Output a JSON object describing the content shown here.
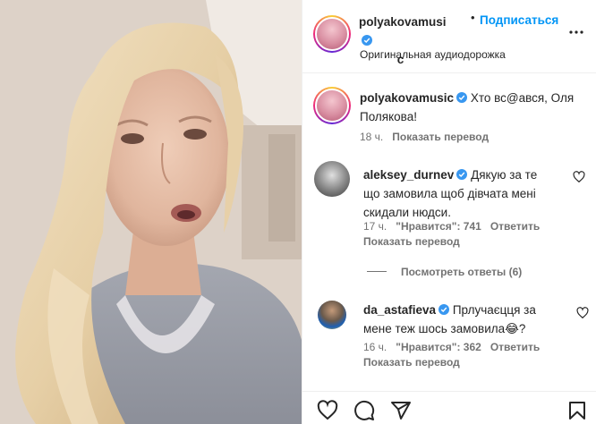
{
  "post": {
    "author": "polyakovamusic",
    "author_line1": "polyakovamusi",
    "author_line2": "c",
    "dot": "•",
    "follow_label": "Подписаться",
    "audio_label": "Оригинальная аудиодорожка"
  },
  "caption": {
    "username": "polyakovamusic",
    "text": "Хто вс@ався, Оля Полякова!",
    "time": "18 ч.",
    "translate": "Показать перевод"
  },
  "comments": [
    {
      "username": "aleksey_durnev",
      "text": "Дякую за те що замовила щоб дівчата мені скидали нюдси.",
      "time": "17 ч.",
      "likes": "\"Нравится\": 741",
      "reply": "Ответить",
      "translate": "Показать перевод"
    },
    {
      "username": "da_astafieva",
      "text": "Прлучаєцця за мене теж шось замовила😂?",
      "time": "16 ч.",
      "likes": "\"Нравится\": 362",
      "reply": "Ответить",
      "translate": "Показать перевод"
    }
  ],
  "replies_label": "Посмотреть ответы (6)",
  "colors": {
    "accent": "#0095f6",
    "verified": "#3897f0",
    "muted": "#737373",
    "text": "#262626"
  },
  "icons": [
    "more-icon",
    "verified-icon",
    "heart-icon",
    "comment-icon",
    "share-icon",
    "bookmark-icon"
  ]
}
